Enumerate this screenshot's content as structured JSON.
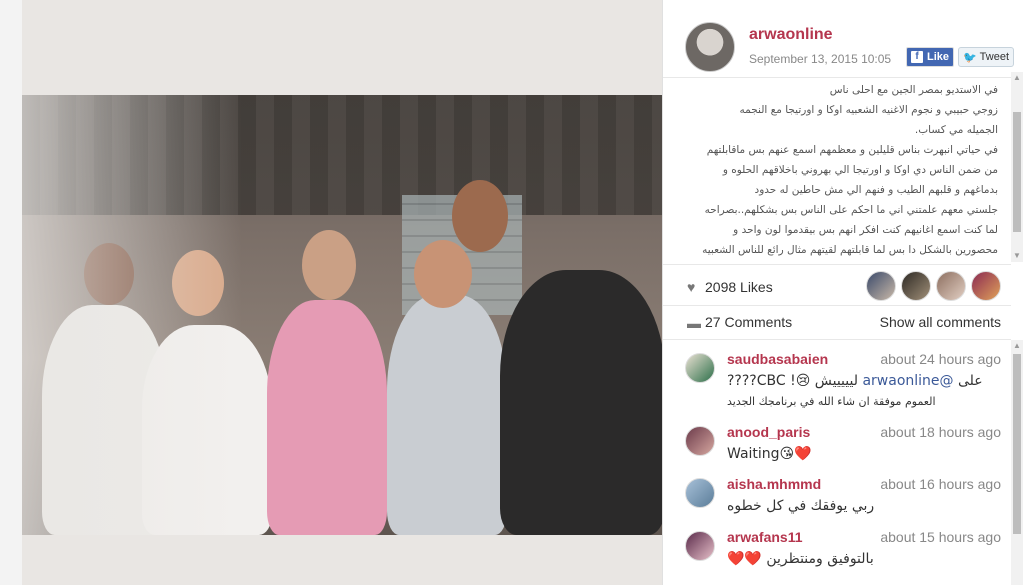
{
  "post": {
    "username": "arwaonline",
    "date": "September 13, 2015 10:05",
    "like_label": "Like",
    "tweet_label": "Tweet",
    "caption": [
      "في الاستديو بمصر الجين مع احلى ناس",
      "زوجي حبيبي و نجوم الاغنيه الشعبيه اوكا و اورتيجا مع النجمه",
      "الجميله مي كساب.",
      "في حياتي انبهرت بناس قليلين و معظمهم اسمع عنهم بس ماقابلتهم",
      "من ضمن الناس دي اوكا و اورتيجا الي بهروني باخلاقهم الحلوه و",
      "بدماغهم و قلبهم الطيب و فنهم الي مش حاطين له حدود",
      "جلستي معهم علمتني اني ما احكم على الناس بس بشكلهم..بصراحه",
      "لما كنت اسمع اغانيهم كنت افكر انهم بس بيقدموا لون واحد و",
      "محصورين بالشكل دا بس لما قابلتهم لقيتهم مثال رائع للناس الشعبيه"
    ],
    "likes": "2098 Likes",
    "comments_count": "27 Comments",
    "show_all": "Show all comments"
  },
  "icons": {
    "heart": "heart-icon",
    "comment": "comment-icon",
    "facebook": "facebook-icon",
    "twitter": "twitter-icon"
  },
  "comments": [
    {
      "user": "saudbasabaien",
      "time": "about 24 hours ago",
      "text_prefix": "على ",
      "mention": "@arwaonline",
      "text_suffix": " ليييييش 😢! CBC????",
      "text2": "العموم موفقة ان شاء الله في برنامجك الجديد"
    },
    {
      "user": "anood_paris",
      "time": "about 18 hours ago",
      "text": "Waiting😘❤️"
    },
    {
      "user": "aisha.mhmmd",
      "time": "about 16 hours ago",
      "text": "ربي يوفقك في كل خطوه"
    },
    {
      "user": "arwafans11",
      "time": "about 15 hours ago",
      "text": "بالتوفيق ومنتظرين ❤️❤️"
    }
  ],
  "colors": {
    "username": "#b5364e",
    "mention": "#3b5998",
    "facebook": "#4267b2",
    "twitter": "#1da1f2"
  }
}
